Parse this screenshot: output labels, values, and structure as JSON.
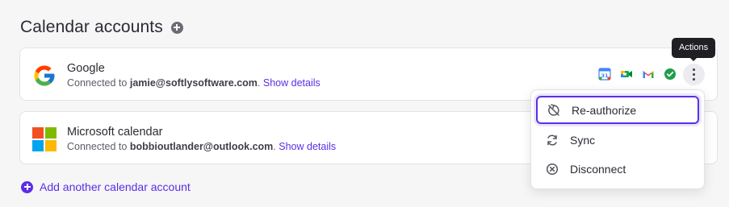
{
  "section": {
    "title": "Calendar accounts",
    "add_link_label": "Add another calendar account"
  },
  "accounts": [
    {
      "name": "Google",
      "connected_prefix": "Connected to ",
      "email": "jamie@softlysoftware.com",
      "details_link": "Show details",
      "icon": "google-logo"
    },
    {
      "name": "Microsoft calendar",
      "connected_prefix": "Connected to ",
      "email": "bobbioutlander@outlook.com",
      "details_link": "Show details",
      "icon": "microsoft-logo"
    }
  ],
  "service_icons": [
    "google-calendar-icon",
    "google-meet-icon",
    "gmail-icon",
    "connected-check-icon"
  ],
  "tooltip": "Actions",
  "menu": {
    "items": [
      {
        "label": "Re-authorize",
        "icon": "reauthorize-icon",
        "highlighted": true
      },
      {
        "label": "Sync",
        "icon": "sync-icon",
        "highlighted": false
      },
      {
        "label": "Disconnect",
        "icon": "disconnect-icon",
        "highlighted": false
      }
    ]
  },
  "colors": {
    "accent": "#5b2ee6",
    "background": "#f6f6f7",
    "card": "#ffffff",
    "tooltip_bg": "#1f1f24",
    "success": "#1e9e4a"
  }
}
